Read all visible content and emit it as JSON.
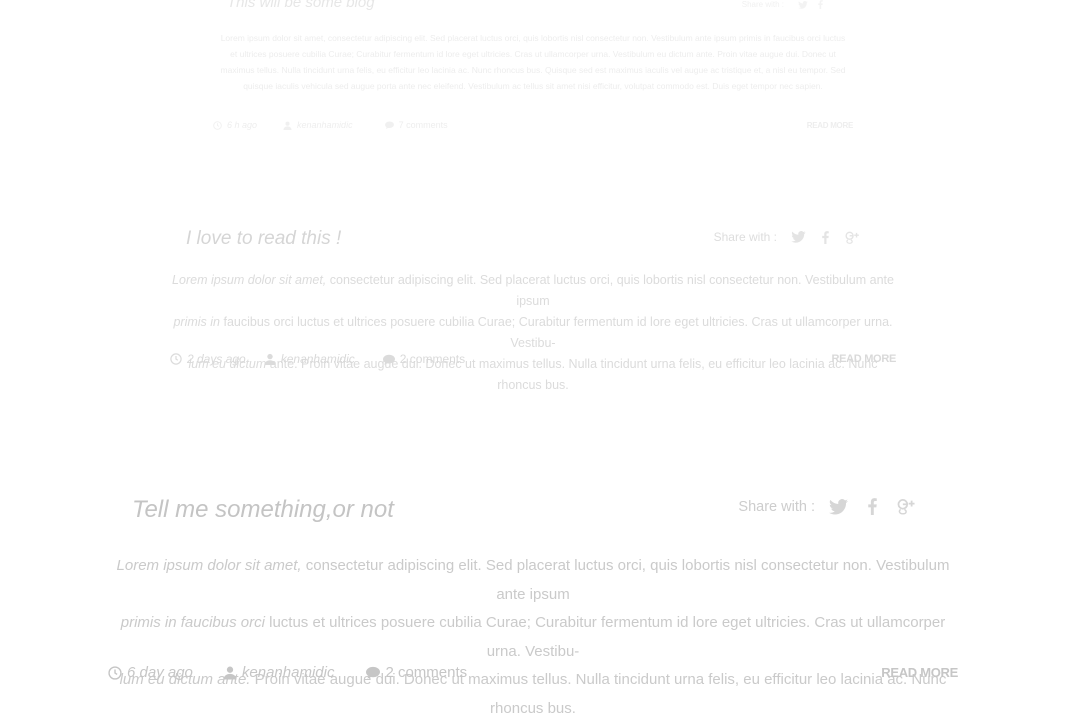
{
  "posts": [
    {
      "title": "This will be some blog",
      "share_label": "Share with :",
      "body_lead": "Lorem ipsum dolor sit amet, consectetur adipiscing elit. Sed placerat luctus orci, quis lobortis nisl consectetur non. Vestibulum ante ipsum primis in faucibus orci luctus et ultrices posuere cubilia Curae; Curabitur fermentum id lore eget ultricies.",
      "body_rest": " Cras ut ullamcorper urna. Vestibulum eu dictum ante. Proin vitae augue dui. Donec ut maximus tellus. Nulla tincidunt urna felis, eu efficitur leo lacinia ac. Nunc rhoncus bus. Quisque sed est maximus iaculis vel augue ac tristique et, a nisl eu tempor. Sed quisque iaculis vehicula sed augue porta ante nec eleifend. Vestibulum ac tellus sit amet nisi efficitur, volutpat commodo est. Duis eget tempor nec sapien.",
      "time": "6 h ago",
      "author": "kenanhamidic",
      "comments": "7 comments",
      "read_more": "READ MORE"
    },
    {
      "title": "I love to read this !",
      "share_label": "Share with :",
      "body_lead": "Lorem ipsum dolor sit amet,",
      "body_lead2": "primis in",
      "body_lead3": "lum eu dictum",
      "body_rest1": " consectetur adipiscing elit. Sed placerat luctus orci, quis lobortis nisl consectetur non. Vestibulum ante ipsum",
      "body_rest2": " faucibus orci luctus et ultrices posuere cubilia Curae; Curabitur fermentum id lore eget ultricies. Cras ut ullamcorper urna. Vestibu-",
      "body_rest3": " ante. Proin vitae augue dui. Donec ut maximus tellus. Nulla tincidunt urna felis, eu efficitur leo lacinia ac. Nunc rhoncus bus.",
      "time": "2 days ago",
      "author": "kenanhamidic",
      "comments": "2 comments",
      "read_more": "READ MORE"
    },
    {
      "title": "Tell me something,or not",
      "share_label": "Share with :",
      "body_lead": "Lorem ipsum dolor sit amet,",
      "body_lead2": "primis in faucibus orci",
      "body_lead3": "lum eu dictum ante.",
      "body_rest1": " consectetur adipiscing elit. Sed placerat luctus orci, quis lobortis nisl consectetur non. Vestibulum ante ipsum",
      "body_rest2": " luctus et ultrices posuere cubilia Curae; Curabitur fermentum id lore eget ultricies. Cras ut ullamcorper urna. Vestibu-",
      "body_rest3": " Proin vitae augue dui. Donec ut maximus tellus. Nulla tincidunt urna felis, eu efficitur leo lacinia ac. Nunc rhoncus bus.",
      "time": "6 day ago",
      "author": "kenanhamidic",
      "comments": "2 comments",
      "read_more": "READ MORE"
    }
  ],
  "icons": {
    "share": [
      "twitter-icon",
      "facebook-icon",
      "google-plus-icon"
    ],
    "meta": [
      "clock-icon",
      "user-icon",
      "comment-icon"
    ]
  },
  "colors": {
    "text_faded": "#cacaca",
    "background": "#ffffff"
  }
}
